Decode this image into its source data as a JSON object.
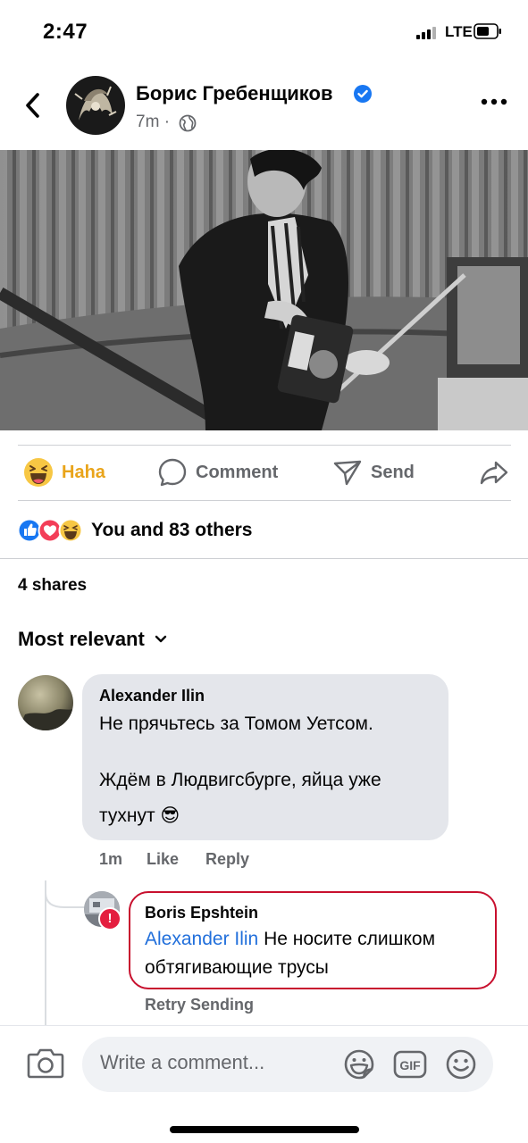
{
  "status_bar": {
    "time": "2:47",
    "network": "LTE"
  },
  "post": {
    "author": "Борис Гребенщиков",
    "time_ago": "7m",
    "meta_separator": "·",
    "reaction_label": "Haha",
    "comment_label": "Comment",
    "send_label": "Send",
    "reactions_summary": "You and 83 others",
    "shares": "4 shares",
    "sort_label": "Most relevant"
  },
  "comments": [
    {
      "author": "Alexander Ilin",
      "line1": "Не прячьтесь за Томом Уетсом.",
      "line2": "Ждём в Людвигсбурге, яйца уже",
      "line3": "тухнут 😎",
      "time": "1m",
      "like_label": "Like",
      "reply_label": "Reply"
    }
  ],
  "reply": {
    "author": "Boris Epshtein",
    "mention": "Alexander Ilin",
    "text_line1_rest": " Не носите слишком",
    "text_line2": "обтягивающие трусы",
    "error_mark": "!",
    "retry_label": "Retry Sending"
  },
  "composer": {
    "placeholder": "Write a comment..."
  },
  "colors": {
    "accent_blue": "#1877f2",
    "haha_yellow": "#e9a41a",
    "error_red": "#c8102e",
    "secondary_text": "#65676b"
  },
  "icons": [
    "back-icon",
    "verified-icon",
    "globe-icon",
    "more-icon",
    "haha-icon",
    "comment-icon",
    "send-icon",
    "share-icon",
    "like-reaction-icon",
    "love-reaction-icon",
    "haha-reaction-icon",
    "chevron-down-icon",
    "camera-icon",
    "sticker-icon",
    "gif-icon",
    "emoji-icon"
  ]
}
